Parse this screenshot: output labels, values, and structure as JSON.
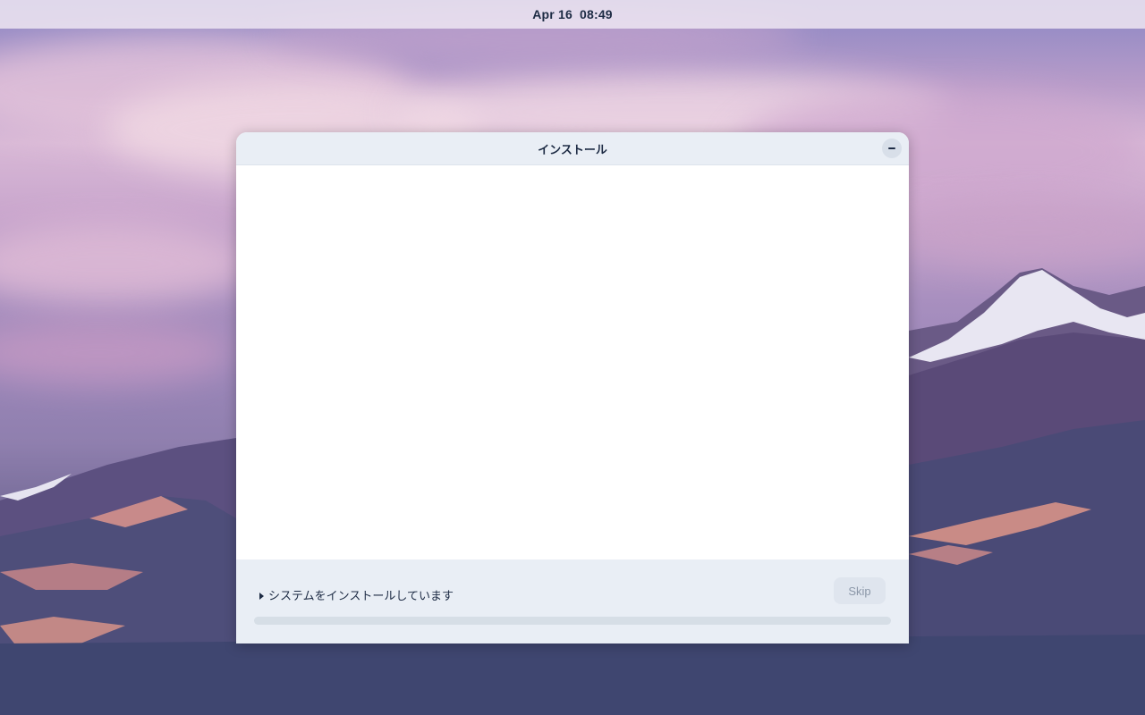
{
  "topbar": {
    "date": "Apr 16",
    "time": "08:49"
  },
  "window": {
    "title": "インストール",
    "minimize_icon": "minimize-icon",
    "status_text": "システムをインストールしています",
    "expander_icon": "disclosure-triangle-icon",
    "skip_label": "Skip",
    "progress": 0
  },
  "colors": {
    "text": "#1d2b44",
    "window_chrome": "#e9eef5",
    "skip_disabled_text": "#8b97a8"
  }
}
